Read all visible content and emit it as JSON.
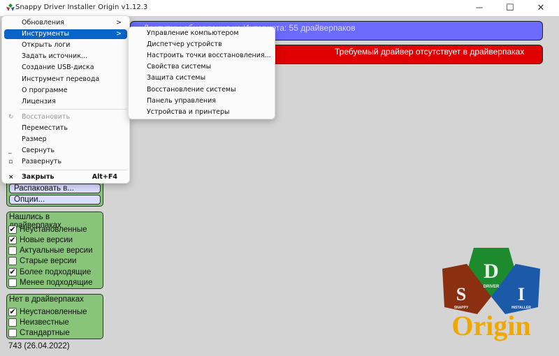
{
  "window": {
    "title": "Snappy Driver Installer Origin v1.12.3"
  },
  "status": {
    "updates": "Доступны обновления из Интернета: 55 драйверпаков",
    "updates_line2": ")",
    "missing": "Требуемый драйвер отсутствует в драйверпаках"
  },
  "system_menu": {
    "items": [
      {
        "label": "Обновления",
        "arrow": ">"
      },
      {
        "label": "Инструменты",
        "arrow": ">"
      },
      {
        "label": "Открыть логи"
      },
      {
        "label": "Задать источник..."
      },
      {
        "label": "Создание USB-диска"
      },
      {
        "label": "Инструмент перевода"
      },
      {
        "label": "О программе"
      },
      {
        "label": "Лицензия"
      }
    ],
    "window_items": [
      {
        "label": "Восстановить",
        "disabled": true
      },
      {
        "label": "Переместить"
      },
      {
        "label": "Размер"
      },
      {
        "label": "Свернуть"
      },
      {
        "label": "Развернуть"
      }
    ],
    "close": {
      "label": "Закрыть",
      "accel": "Alt+F4"
    }
  },
  "tools_submenu": [
    "Управление компьютером",
    "Диспетчер устройств",
    "Настроить точки восстановления...",
    "Свойства системы",
    "Защита системы",
    "Восстановление системы",
    "Панель управления",
    "Устройства и принтеры"
  ],
  "buttons": {
    "extract": "Распаковать в...",
    "options": "Опции..."
  },
  "found": {
    "title": "Нашлись в драйверпаках",
    "items": [
      {
        "label": "Неустановленные",
        "checked": true
      },
      {
        "label": "Новые версии",
        "checked": true
      },
      {
        "label": "Актуальные версии",
        "checked": false
      },
      {
        "label": "Старые версии",
        "checked": false
      },
      {
        "label": "Более подходящие",
        "checked": true
      },
      {
        "label": "Менее подходящие",
        "checked": false
      }
    ]
  },
  "notfound": {
    "title": "Нет в драйверпаках",
    "items": [
      {
        "label": "Неустановленные",
        "checked": true
      },
      {
        "label": "Неизвестные",
        "checked": false
      },
      {
        "label": "Стандартные",
        "checked": false
      }
    ]
  },
  "version": "743 (26.04.2022)",
  "logo": {
    "d": "D",
    "driver": "DRIVER",
    "s": "S",
    "snappy": "SNAPPY",
    "i": "I",
    "installer": "INSTALLER",
    "origin": "Origin"
  }
}
